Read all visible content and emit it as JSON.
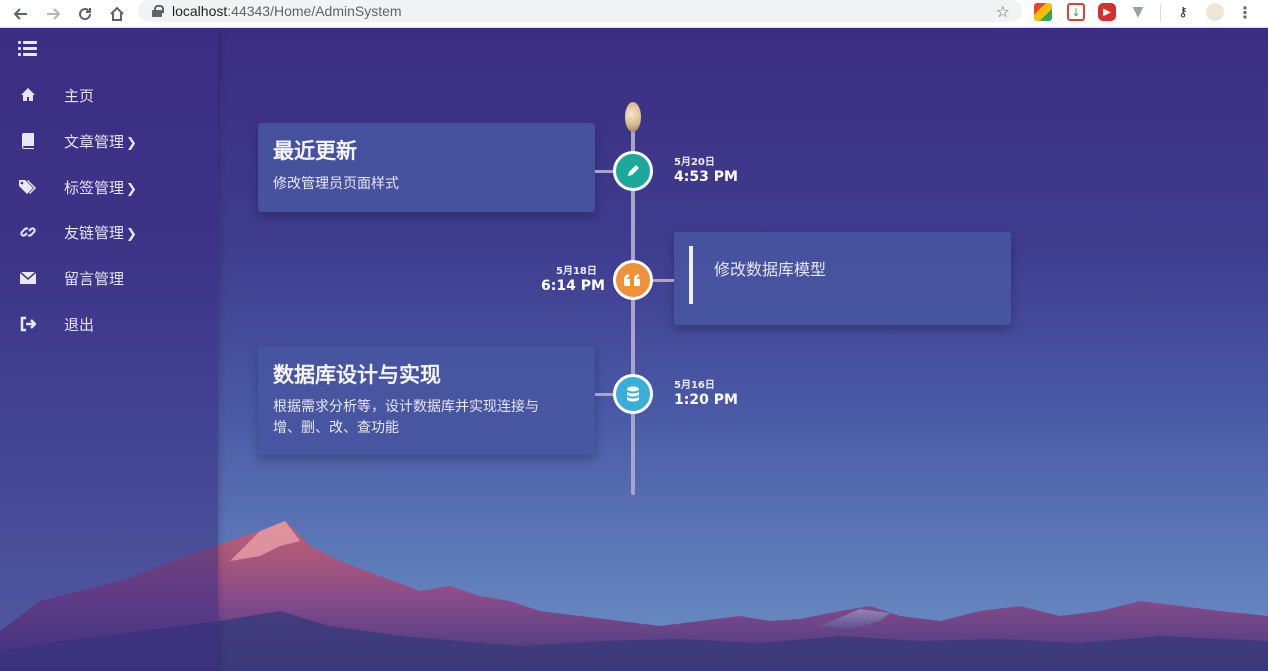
{
  "browser": {
    "url_host": "localhost",
    "url_path": ":44343/Home/AdminSystem"
  },
  "sidebar": {
    "items": [
      {
        "label": "主页",
        "icon": "home-icon",
        "has_submenu": false
      },
      {
        "label": "文章管理",
        "icon": "book-icon",
        "has_submenu": true
      },
      {
        "label": "标签管理",
        "icon": "tags-icon",
        "has_submenu": true
      },
      {
        "label": "友链管理",
        "icon": "link-icon",
        "has_submenu": true
      },
      {
        "label": "留言管理",
        "icon": "envelope-icon",
        "has_submenu": false
      },
      {
        "label": "退出",
        "icon": "sign-out-icon",
        "has_submenu": false
      }
    ],
    "caret": "❯"
  },
  "timeline": {
    "entries": [
      {
        "title": "最近更新",
        "text": "修改管理员页面样式",
        "date": "5月20日",
        "time": "4:53 PM",
        "icon": "pencil-icon",
        "color": "#1aa99a"
      },
      {
        "title": "",
        "text": "修改数据库模型",
        "date": "5月18日",
        "time": "6:14 PM",
        "icon": "quote-icon",
        "color": "#f0913a"
      },
      {
        "title": "数据库设计与实现",
        "text_line1": "根据需求分析等，设计数据库并实现连接与",
        "text_line2": "增、删、改、查功能",
        "date": "5月16日",
        "time": "1:20 PM",
        "icon": "database-icon",
        "color": "#3aaed8"
      }
    ]
  }
}
